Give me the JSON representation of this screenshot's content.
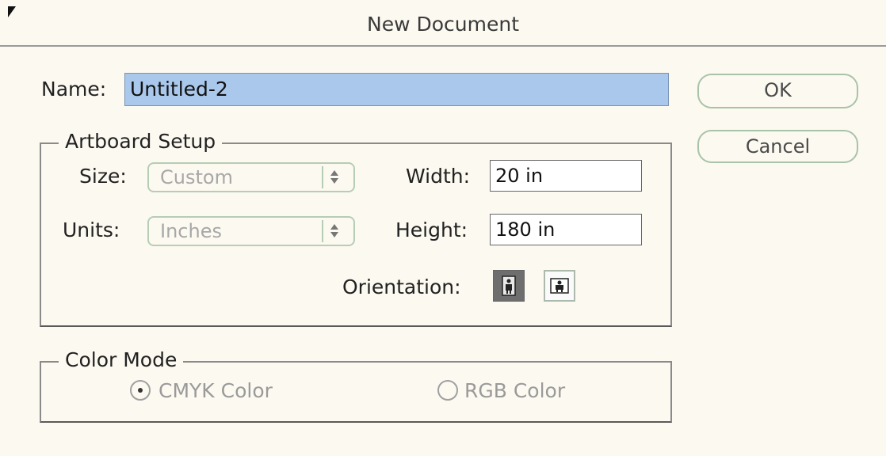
{
  "window": {
    "title": "New Document"
  },
  "name_field": {
    "label": "Name:",
    "value": "Untitled-2"
  },
  "buttons": {
    "ok": "OK",
    "cancel": "Cancel"
  },
  "artboard": {
    "group_title": "Artboard Setup",
    "size": {
      "label": "Size:",
      "value": "Custom"
    },
    "units": {
      "label": "Units:",
      "value": "Inches"
    },
    "width": {
      "label": "Width:",
      "value": "20 in"
    },
    "height": {
      "label": "Height:",
      "value": "180 in"
    },
    "orientation": {
      "label": "Orientation:",
      "selected": "portrait",
      "options": [
        "portrait-icon",
        "landscape-icon"
      ]
    }
  },
  "color_mode": {
    "group_title": "Color Mode",
    "options": [
      {
        "label": "CMYK Color",
        "selected": true
      },
      {
        "label": "RGB Color",
        "selected": false
      }
    ]
  },
  "colors": {
    "background": "#fcf9f0",
    "name_field_highlight": "#a9c8ec",
    "button_border": "#a9c3a9",
    "orientation_selected": "#6e6e6e"
  }
}
